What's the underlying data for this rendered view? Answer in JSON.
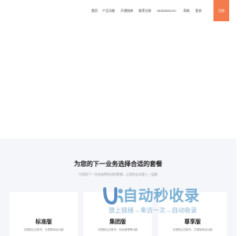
{
  "nav": {
    "items": [
      "首页",
      "产品功能",
      "开通指南",
      "推荐注册",
      "18052681010",
      "帮助",
      "登录"
    ],
    "cta": "注册"
  },
  "section": {
    "title": "为您的下一业务选择合适的套餐",
    "subtitle": "为您的下一业务选择合适的套餐，让您的业务更上一层楼"
  },
  "plans": [
    {
      "name": "标准版",
      "desc": "无限制企业账号，无限制地址功能"
    },
    {
      "name": "集团版",
      "desc": "无限制企业账号，地址管理等功能"
    },
    {
      "name": "尊享版",
      "desc": "无限制企业账号，无限制地址功能"
    }
  ],
  "watermark": {
    "title": "自动秒收录",
    "tagline": "放上链接→来访一次→自动收录",
    "colors": {
      "primary": "#7ab0d4",
      "logo": "#5b8fc4"
    }
  },
  "colors": {
    "accent": "#f47c4c",
    "section_bg": "#f5f6fa",
    "title": "#222222",
    "muted": "#999999"
  }
}
